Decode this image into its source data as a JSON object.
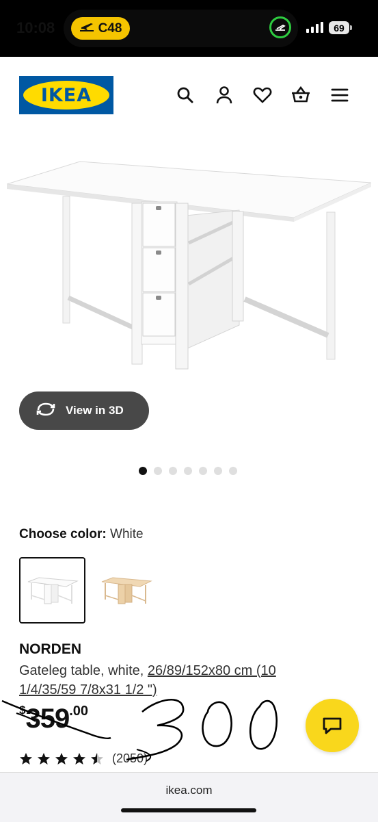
{
  "status_bar": {
    "time": "10:08",
    "flight_code": "C48",
    "battery": "69"
  },
  "header": {
    "logo_text": "IKEA",
    "icons": [
      "search-icon",
      "account-icon",
      "heart-icon",
      "basket-icon",
      "menu-icon"
    ]
  },
  "gallery": {
    "view3d_label": "View in 3D",
    "image_count": 7,
    "active_index": 0
  },
  "color": {
    "label": "Choose color:",
    "value": "White",
    "options": [
      "White",
      "Birch"
    ]
  },
  "product": {
    "name": "NORDEN",
    "description_prefix": "Gateleg table, white, ",
    "dimensions_link": "26/89/152x80 cm (10 1/4/35/59 7/8x31 1/2 \")",
    "price_currency": "$",
    "price_main": "359",
    "price_cents": ".00",
    "rating_value": 4.5,
    "review_count": "(2050)"
  },
  "annotation": {
    "handwritten_price": "300"
  },
  "footer": {
    "domain": "ikea.com"
  },
  "colors": {
    "ikea_blue": "#0058a3",
    "ikea_yellow": "#ffdb00",
    "chat_yellow": "#f9d71c",
    "button_dark": "#484848"
  }
}
